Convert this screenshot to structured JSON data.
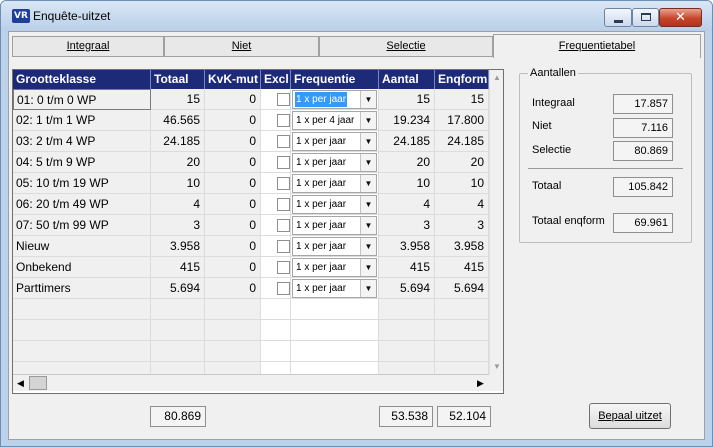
{
  "window": {
    "title": "Enquête-uitzet",
    "logo_text": "VR"
  },
  "tabs": [
    {
      "label": "Integraal"
    },
    {
      "label": "Niet"
    },
    {
      "label": "Selectie"
    },
    {
      "label": "Frequentietabel",
      "active": true
    }
  ],
  "grid": {
    "columns": [
      "Grootteklasse",
      "Totaal",
      "KvK-mut",
      "Excl",
      "Frequentie",
      "Aantal",
      "Enqform"
    ],
    "rows": [
      {
        "klasse": "01: 0 t/m 0 WP",
        "totaal": "15",
        "kvk": "0",
        "excl": false,
        "freq": "1 x per jaar",
        "aantal": "15",
        "enqform": "15"
      },
      {
        "klasse": "02: 1 t/m 1 WP",
        "totaal": "46.565",
        "kvk": "0",
        "excl": false,
        "freq": "1 x per 4 jaar",
        "aantal": "19.234",
        "enqform": "17.800"
      },
      {
        "klasse": "03: 2 t/m 4 WP",
        "totaal": "24.185",
        "kvk": "0",
        "excl": false,
        "freq": "1 x per jaar",
        "aantal": "24.185",
        "enqform": "24.185"
      },
      {
        "klasse": "04: 5 t/m 9 WP",
        "totaal": "20",
        "kvk": "0",
        "excl": false,
        "freq": "1 x per jaar",
        "aantal": "20",
        "enqform": "20"
      },
      {
        "klasse": "05: 10 t/m 19 WP",
        "totaal": "10",
        "kvk": "0",
        "excl": false,
        "freq": "1 x per jaar",
        "aantal": "10",
        "enqform": "10"
      },
      {
        "klasse": "06: 20 t/m 49 WP",
        "totaal": "4",
        "kvk": "0",
        "excl": false,
        "freq": "1 x per jaar",
        "aantal": "4",
        "enqform": "4"
      },
      {
        "klasse": "07: 50 t/m 99 WP",
        "totaal": "3",
        "kvk": "0",
        "excl": false,
        "freq": "1 x per jaar",
        "aantal": "3",
        "enqform": "3"
      },
      {
        "klasse": "Nieuw",
        "totaal": "3.958",
        "kvk": "0",
        "excl": false,
        "freq": "1 x per jaar",
        "aantal": "3.958",
        "enqform": "3.958"
      },
      {
        "klasse": "Onbekend",
        "totaal": "415",
        "kvk": "0",
        "excl": false,
        "freq": "1 x per jaar",
        "aantal": "415",
        "enqform": "415"
      },
      {
        "klasse": "Parttimers",
        "totaal": "5.694",
        "kvk": "0",
        "excl": false,
        "freq": "1 x per jaar",
        "aantal": "5.694",
        "enqform": "5.694"
      }
    ],
    "selected_row": 0
  },
  "totals": {
    "totaal": "80.869",
    "aantal": "53.538",
    "enqform": "52.104"
  },
  "aantallen": {
    "title": "Aantallen",
    "integraal_label": "Integraal",
    "integraal_value": "17.857",
    "niet_label": "Niet",
    "niet_value": "7.116",
    "selectie_label": "Selectie",
    "selectie_value": "80.869",
    "totaal_label": "Totaal",
    "totaal_value": "105.842",
    "totaal_enqform_label": "Totaal enqform",
    "totaal_enqform_value": "69.961"
  },
  "buttons": {
    "bepaal_label": "Bepaal uitzet"
  },
  "colors": {
    "header_bg": "#1c2a78",
    "highlight": "#3399ff",
    "close_button": "#c7452c"
  }
}
